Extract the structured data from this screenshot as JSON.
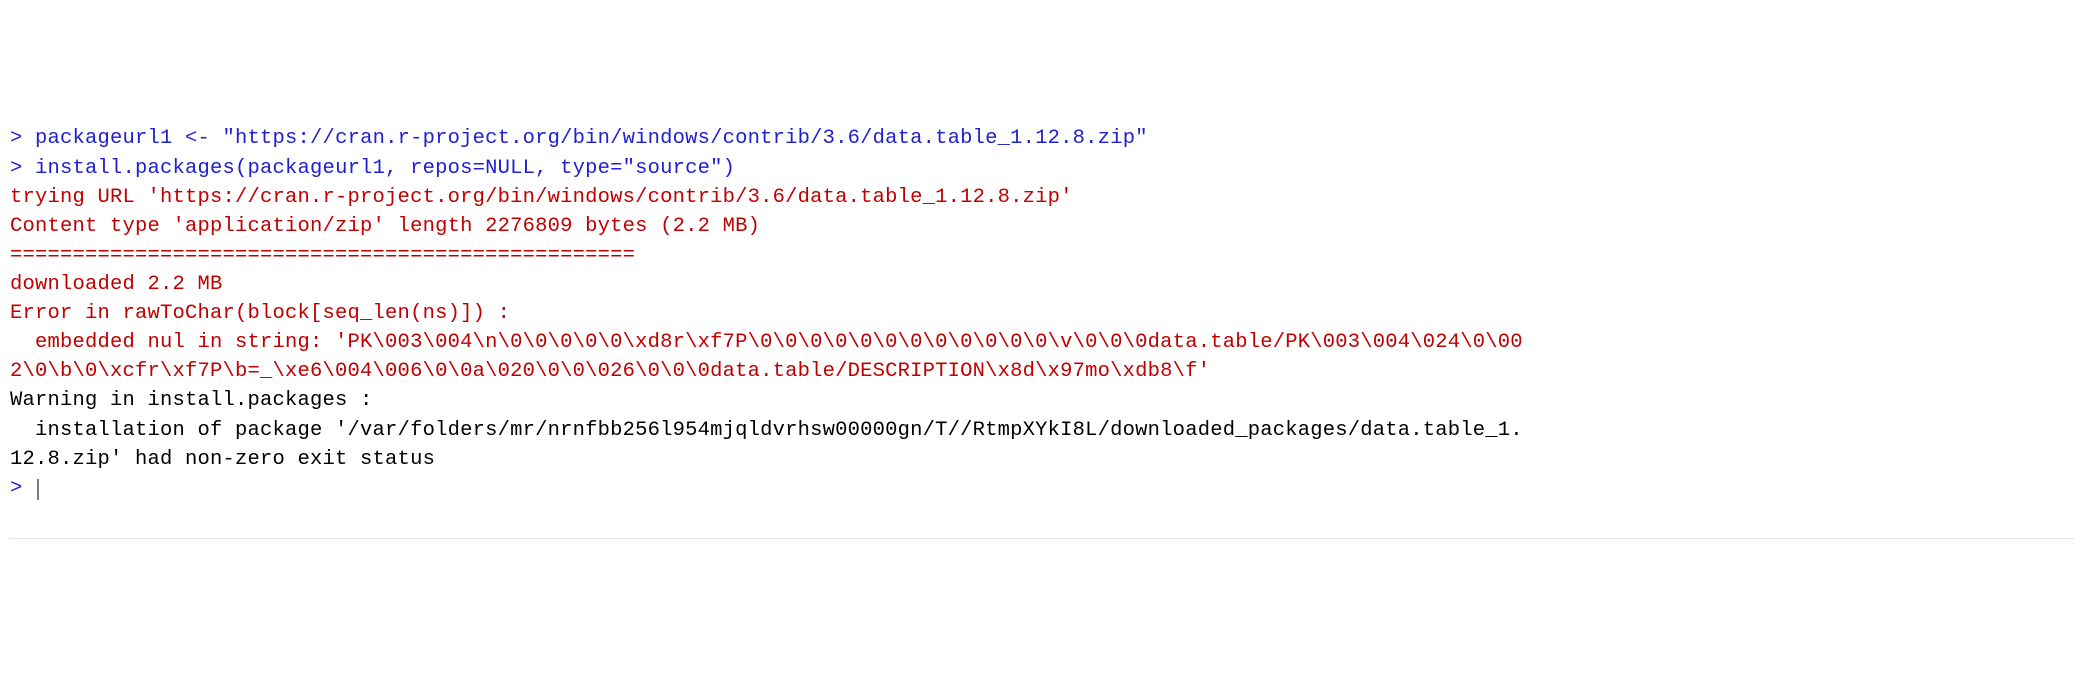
{
  "console": {
    "lines": [
      {
        "cls": "input",
        "prompt": "> ",
        "text": "packageurl1 <- \"https://cran.r-project.org/bin/windows/contrib/3.6/data.table_1.12.8.zip\""
      },
      {
        "cls": "input",
        "prompt": "> ",
        "text": "install.packages(packageurl1, repos=NULL, type=\"source\")"
      },
      {
        "cls": "msg",
        "prompt": "",
        "text": "trying URL 'https://cran.r-project.org/bin/windows/contrib/3.6/data.table_1.12.8.zip'"
      },
      {
        "cls": "msg",
        "prompt": "",
        "text": "Content type 'application/zip' length 2276809 bytes (2.2 MB)"
      },
      {
        "cls": "msg",
        "prompt": "",
        "text": "=================================================="
      },
      {
        "cls": "msg",
        "prompt": "",
        "text": "downloaded 2.2 MB"
      },
      {
        "cls": "msg",
        "prompt": "",
        "text": ""
      },
      {
        "cls": "msg",
        "prompt": "",
        "text": "Error in rawToChar(block[seq_len(ns)]) : "
      },
      {
        "cls": "msg",
        "prompt": "",
        "text": "  embedded nul in string: 'PK\\003\\004\\n\\0\\0\\0\\0\\0\\xd8r\\xf7P\\0\\0\\0\\0\\0\\0\\0\\0\\0\\0\\0\\0\\v\\0\\0\\0data.table/PK\\003\\004\\024\\0\\002\\0\\b\\0\\xcfr\\xf7P\\b=_\\xe6\\004\\006\\0\\0a\\020\\0\\0\\026\\0\\0\\0data.table/DESCRIPTION\\x8d\\x97mo\\xdb8\\f'"
      },
      {
        "cls": "plain",
        "prompt": "",
        "text": "Warning in install.packages :"
      },
      {
        "cls": "plain",
        "prompt": "",
        "text": "  installation of package '/var/folders/mr/nrnfbb256l954mjqldvrhsw00000gn/T//RtmpXYkI8L/downloaded_packages/data.table_1.12.8.zip' had non-zero exit status"
      },
      {
        "cls": "input",
        "prompt": "> ",
        "text": "",
        "cursor": true
      }
    ]
  }
}
